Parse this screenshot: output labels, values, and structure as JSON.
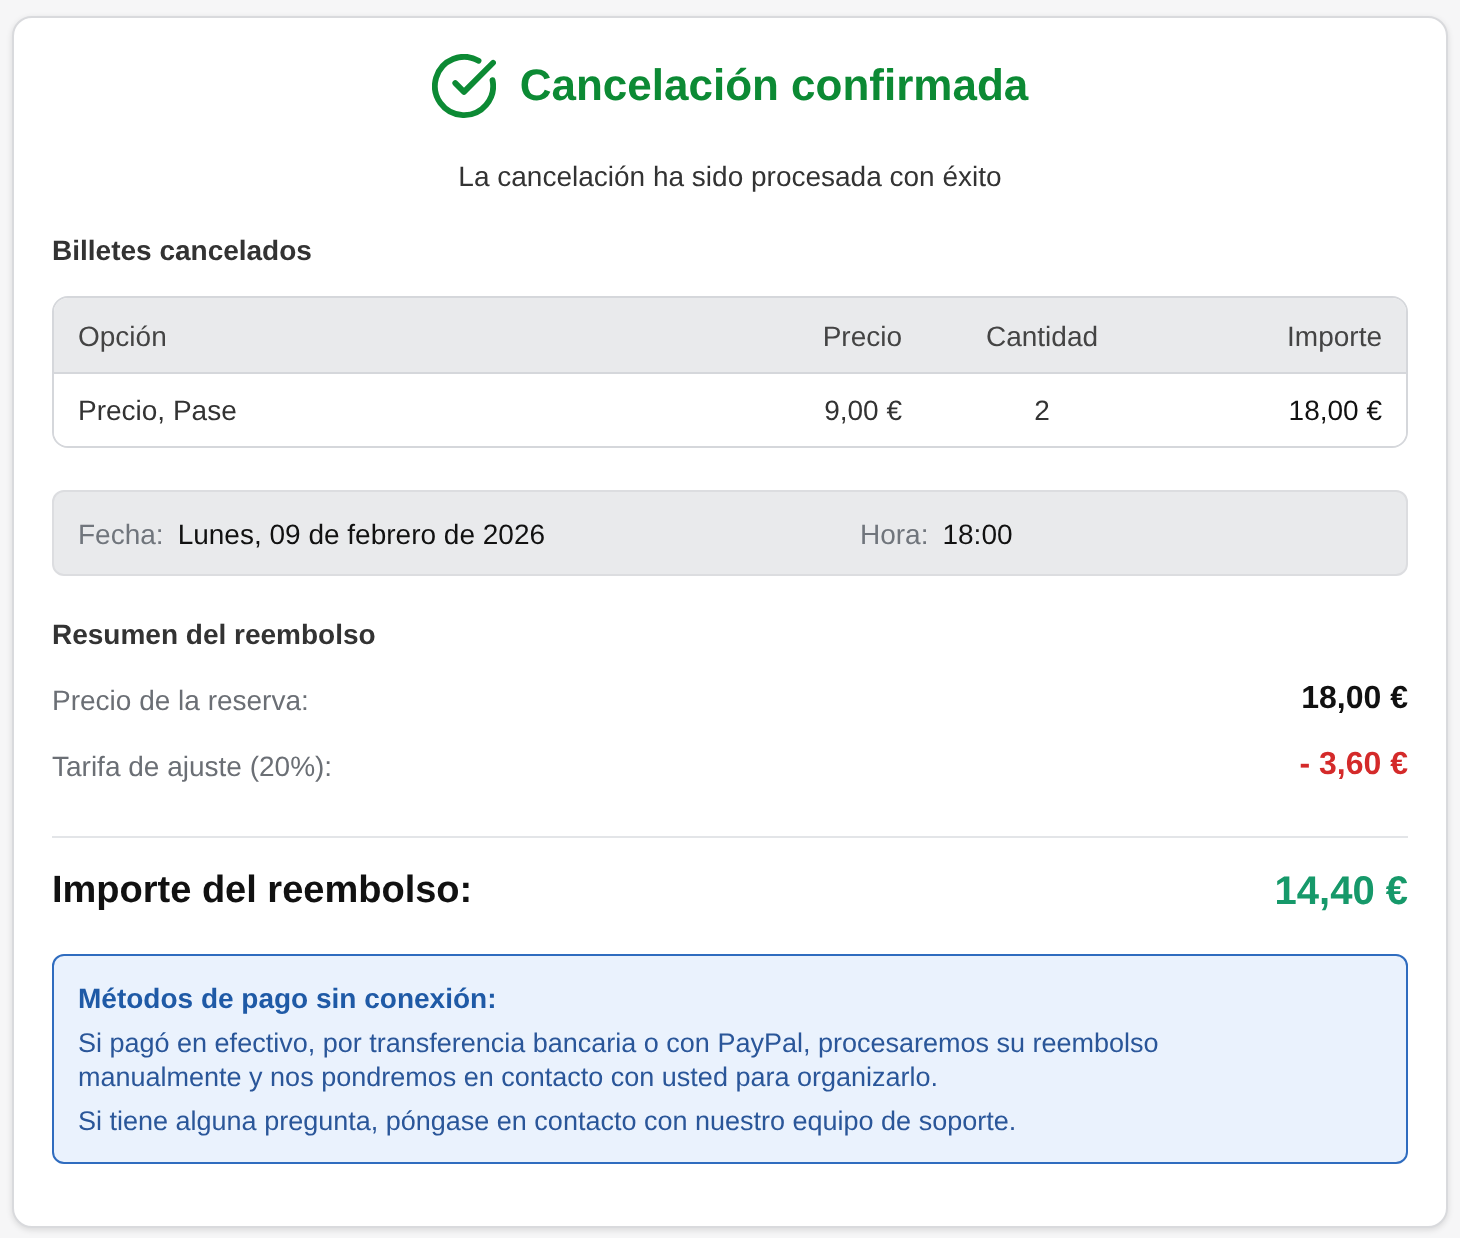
{
  "header": {
    "title": "Cancelación confirmada",
    "subtitle": "La cancelación ha sido procesada con éxito"
  },
  "tickets": {
    "heading": "Billetes cancelados",
    "columns": [
      "Opción",
      "Precio",
      "Cantidad",
      "Importe"
    ],
    "rows": [
      {
        "cells": [
          "Precio, Pase",
          "9,00 €",
          "2",
          "18,00 €"
        ]
      }
    ]
  },
  "booking": {
    "date_label": "Fecha:",
    "date": "Lunes, 09 de febrero de 2026",
    "time_label": "Hora:",
    "time": "18:00"
  },
  "refund_summary": {
    "heading": "Resumen del reembolso",
    "lines": [
      {
        "label": "Precio de la reserva:",
        "amount": "18,00 €",
        "kind": "price"
      },
      {
        "label": "Tarifa de ajuste (20%):",
        "amount": "- 3,60 €",
        "kind": "deduction"
      }
    ],
    "total": {
      "label": "Importe del reembolso:",
      "amount": "14,40 €"
    }
  },
  "notice": {
    "title": "Métodos de pago sin conexión:",
    "paragraphs": [
      "Si pagó en efectivo, por transferencia bancaria o con PayPal, procesaremos su reembolso manualmente y nos pondremos en contacto con usted para organizarlo.",
      "Si tiene alguna pregunta, póngase en contacto con nuestro equipo de soporte."
    ]
  }
}
